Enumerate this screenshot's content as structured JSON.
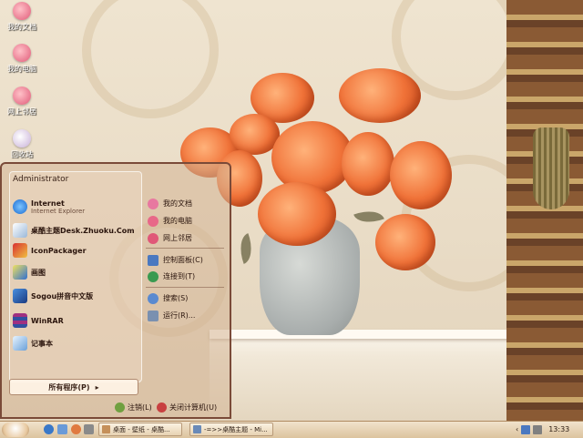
{
  "desktop": {
    "icons": [
      {
        "label": "我的文档",
        "icon": "my-documents-icon"
      },
      {
        "label": "我的电脑",
        "icon": "my-computer-icon"
      },
      {
        "label": "网上邻居",
        "icon": "network-icon"
      },
      {
        "label": "回收站",
        "icon": "recycle-bin-icon"
      }
    ]
  },
  "start_menu": {
    "user": "Administrator",
    "programs": [
      {
        "title": "Internet",
        "subtitle": "Internet Explorer",
        "icon": "internet-explorer-icon"
      },
      {
        "title": "桌酷主题Desk.Zhuoku.Com",
        "subtitle": "",
        "icon": "zhuoku-icon"
      },
      {
        "title": "IconPackager",
        "subtitle": "",
        "icon": "iconpackager-icon"
      },
      {
        "title": "画图",
        "subtitle": "",
        "icon": "paint-icon"
      },
      {
        "title": "Sogou拼音中文版",
        "subtitle": "",
        "icon": "sogou-icon"
      },
      {
        "title": "WinRAR",
        "subtitle": "",
        "icon": "winrar-icon"
      },
      {
        "title": "记事本",
        "subtitle": "",
        "icon": "notepad-icon"
      }
    ],
    "right_items": [
      {
        "label": "我的文档",
        "icon": "my-documents-icon"
      },
      {
        "label": "我的电脑",
        "icon": "my-computer-icon"
      },
      {
        "label": "网上邻居",
        "icon": "network-icon"
      },
      {
        "label": "控制面板(C)",
        "icon": "control-panel-icon"
      },
      {
        "label": "连接到(T)",
        "icon": "connect-icon"
      },
      {
        "label": "搜索(S)",
        "icon": "search-icon"
      },
      {
        "label": "运行(R)...",
        "icon": "run-icon"
      }
    ],
    "all_programs": "所有程序(P)",
    "logoff": "注销(L)",
    "shutdown": "关闭计算机(U)"
  },
  "taskbar": {
    "buttons": [
      {
        "label": "桌面 - 壁纸 - 桌酷..."
      },
      {
        "label": "-=>>桌酷主题 - Mi..."
      }
    ],
    "clock": "13:33"
  }
}
